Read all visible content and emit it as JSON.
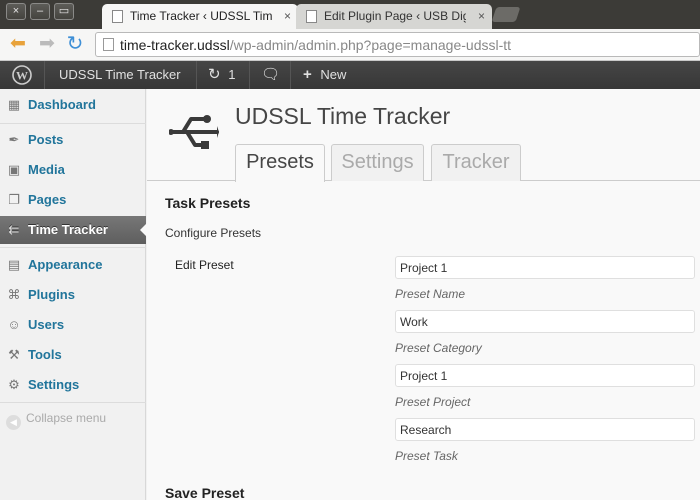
{
  "browser": {
    "window_buttons": [
      "×",
      "–",
      "▭"
    ],
    "tabs": [
      {
        "label": "Time Tracker ‹ UDSSL Tim",
        "close": "×",
        "active": true
      },
      {
        "label": "Edit Plugin Page ‹ USB Dig",
        "close": "×",
        "active": false
      }
    ],
    "url_host": "time-tracker.udssl",
    "url_path": "/wp-admin/admin.php?page=manage-udssl-tt"
  },
  "adminbar": {
    "site_name": "UDSSL Time Tracker",
    "updates_count": "1",
    "new_label": "New",
    "new_plus": "+"
  },
  "sidebar": {
    "items": [
      {
        "label": "Dashboard",
        "icon": "dashboard-icon"
      },
      {
        "label": "Posts",
        "icon": "pin-icon"
      },
      {
        "label": "Media",
        "icon": "media-icon"
      },
      {
        "label": "Pages",
        "icon": "pages-icon"
      },
      {
        "label": "Time Tracker",
        "icon": "usb-icon",
        "current": true
      },
      {
        "label": "Appearance",
        "icon": "appearance-icon"
      },
      {
        "label": "Plugins",
        "icon": "plugins-icon"
      },
      {
        "label": "Users",
        "icon": "users-icon"
      },
      {
        "label": "Tools",
        "icon": "tools-icon"
      },
      {
        "label": "Settings",
        "icon": "settings-icon"
      }
    ],
    "collapse_label": "Collapse menu"
  },
  "main": {
    "title": "UDSSL Time Tracker",
    "tabs": [
      "Presets",
      "Settings",
      "Tracker"
    ],
    "active_tab": "Presets",
    "section_title": "Task Presets",
    "section_desc": "Configure Presets",
    "field_label": "Edit Preset",
    "fields": [
      {
        "value": "Project 1",
        "description": "Preset Name"
      },
      {
        "value": "Work",
        "description": "Preset Category"
      },
      {
        "value": "Project 1",
        "description": "Preset Project"
      },
      {
        "value": "Research",
        "description": "Preset Task"
      }
    ],
    "next_section_title": "Save Preset"
  },
  "colors": {
    "link_blue": "#21759b",
    "adminbar_bg": "#464646",
    "current_menu_bg": "#6d6d6d"
  }
}
